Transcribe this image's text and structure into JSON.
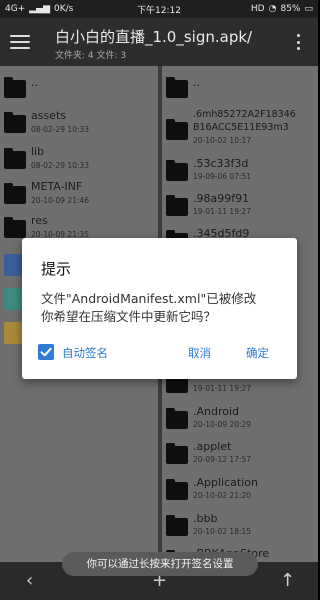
{
  "status_bar": {
    "network": "4G+",
    "speed": "0K/s",
    "time": "下午12:12",
    "hd": "HD",
    "battery": "85%"
  },
  "toolbar": {
    "title": "白小白的直播_1.0_sign.apk/",
    "subtitle": "文件夹: 4  文件: 3"
  },
  "left_pane": {
    "items": [
      {
        "name": "..",
        "date": ""
      },
      {
        "name": "assets",
        "date": "08-02-29 10:33"
      },
      {
        "name": "lib",
        "date": "08-02-29 10:33"
      },
      {
        "name": "META-INF",
        "date": "20-10-09 21:46"
      },
      {
        "name": "res",
        "date": "20-10-09 21:35"
      }
    ]
  },
  "right_pane": {
    "items": [
      {
        "name": "..",
        "date": ""
      },
      {
        "name": ".6mh85272A2F18346\nB16ACC5E11E93m3",
        "date": "20-10-02 10:17"
      },
      {
        "name": ".53c33f3d",
        "date": "19-09-06 07:51"
      },
      {
        "name": ".98a99f91",
        "date": "19-01-11 19:27"
      },
      {
        "name": ".345d5fd9",
        "date": ""
      },
      {
        "name": ".android",
        "date": "19-01-11 19:27"
      },
      {
        "name": ".Android",
        "date": "20-10-09 20:29"
      },
      {
        "name": ".applet",
        "date": "20-09-12 17:57"
      },
      {
        "name": ".Application",
        "date": "20-10-02 21:20"
      },
      {
        "name": ".bbb",
        "date": "20-10-02 18:15"
      },
      {
        "name": ".BBKAppStore",
        "date": ""
      }
    ]
  },
  "dialog": {
    "title": "提示",
    "message": "文件\"AndroidManifest.xml\"已被修改\n你希望在压缩文件中更新它吗？",
    "checkbox_label": "自动签名",
    "checkbox_checked": true,
    "cancel_label": "取消",
    "ok_label": "确定"
  },
  "toast": {
    "text": "你可以通过长按来打开签名设置"
  },
  "bottom_bar": {
    "back_icon": "‹",
    "add_icon": "+",
    "up_icon": "↑"
  },
  "colors": {
    "accent": "#2e7bd4",
    "toolbar": "#2d2d2d",
    "pane_bg": "#6f6f6f"
  }
}
